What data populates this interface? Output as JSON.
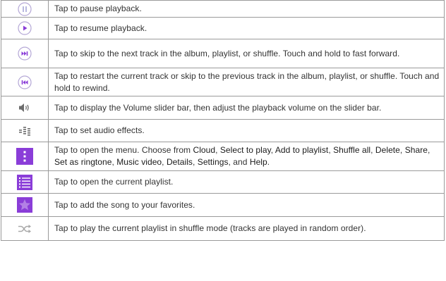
{
  "colors": {
    "circle_border": "#b4a7d6",
    "purple_icon": "#8a3dd8",
    "gray_icon": "#6c6c6c",
    "light_gray_icon": "#a9a9a9",
    "text": "#333333",
    "border": "#9a9a9a"
  },
  "rows": [
    {
      "icon": "pause-icon",
      "text": "Tap to pause playback."
    },
    {
      "icon": "play-icon",
      "text": "Tap to resume playback."
    },
    {
      "icon": "next-track-icon",
      "text": "Tap to skip to the next track in the album, playlist, or shuffle. Touch and hold to fast forward."
    },
    {
      "icon": "previous-track-icon",
      "text": "Tap to restart the current track or skip to the previous track in the album, playlist, or shuffle. Touch and hold to rewind."
    },
    {
      "icon": "volume-icon",
      "text": "Tap to display the Volume slider bar, then adjust the playback volume on the slider bar."
    },
    {
      "icon": "audio-effects-icon",
      "text": "Tap to set audio effects."
    },
    {
      "icon": "menu-icon",
      "text_intro": "Tap to open the menu. Choose from ",
      "menu_items": [
        "Cloud",
        "Select to play",
        "Add to playlist",
        "Shuffle all",
        "Delete",
        "Share",
        "Set as ringtone",
        "Music video",
        "Details",
        "Settings",
        "Help"
      ],
      "sep_comma": ", ",
      "sep_last": ", and ",
      "text_end": "."
    },
    {
      "icon": "playlist-icon",
      "text": "Tap to open the current playlist."
    },
    {
      "icon": "favorite-star-icon",
      "text": "Tap to add the song to your favorites."
    },
    {
      "icon": "shuffle-icon",
      "text": "Tap to play the current playlist in shuffle mode (tracks are played in random order)."
    }
  ]
}
